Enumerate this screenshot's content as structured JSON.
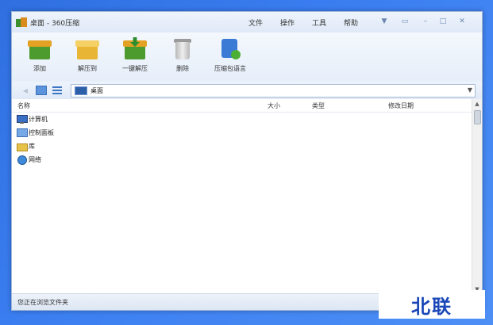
{
  "window": {
    "title": "桌面 - 360压缩",
    "menus": [
      "文件",
      "操作",
      "工具",
      "帮助"
    ],
    "controls": {
      "skin": "▼",
      "msg": "▭",
      "min": "–",
      "max": "□",
      "close": "✕"
    }
  },
  "toolbar": {
    "items": [
      {
        "label": "添加",
        "icon": "add-archive-icon"
      },
      {
        "label": "解压到",
        "icon": "extract-to-icon"
      },
      {
        "label": "一键解压",
        "icon": "one-click-extract-icon"
      },
      {
        "label": "删除",
        "icon": "trash-icon"
      },
      {
        "label": "压缩包语言",
        "icon": "archive-language-icon"
      }
    ]
  },
  "address": {
    "back": "◀",
    "path": "桌面",
    "dropdown": "▼"
  },
  "columns": {
    "name": "名称",
    "size": "大小",
    "type": "类型",
    "modified": "修改日期"
  },
  "items": [
    {
      "name": "计算机",
      "icon": "computer-icon"
    },
    {
      "name": "控制面板",
      "icon": "control-panel-icon"
    },
    {
      "name": "库",
      "icon": "library-icon"
    },
    {
      "name": "网络",
      "icon": "network-icon"
    }
  ],
  "status": "您正在浏览文件夹",
  "watermark": "北联"
}
